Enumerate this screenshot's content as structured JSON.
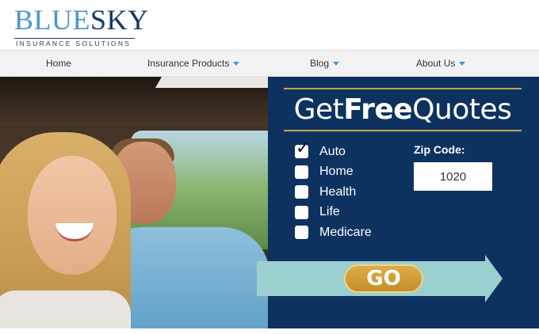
{
  "logo": {
    "blue_text": "BLUE",
    "sky_text": "SKY",
    "tagline": "INSURANCE SOLUTIONS"
  },
  "nav": [
    {
      "label": "Home",
      "has_dropdown": false
    },
    {
      "label": "Insurance Products",
      "has_dropdown": true
    },
    {
      "label": "Blog",
      "has_dropdown": true
    },
    {
      "label": "About Us",
      "has_dropdown": true
    }
  ],
  "quote": {
    "title_prefix": "Get",
    "title_bold": "Free",
    "title_suffix": "Quotes",
    "options": [
      {
        "label": "Auto",
        "checked": true
      },
      {
        "label": "Home",
        "checked": false
      },
      {
        "label": "Health",
        "checked": false
      },
      {
        "label": "Life",
        "checked": false
      },
      {
        "label": "Medicare",
        "checked": false
      }
    ],
    "zip_label": "Zip Code:",
    "zip_value": "1020",
    "go_label": "GO"
  },
  "colors": {
    "brand_navy": "#0d3260",
    "brand_blue": "#4a97cf",
    "accent_gold": "#c8a24a",
    "arrow_teal": "#9ccfd0"
  }
}
